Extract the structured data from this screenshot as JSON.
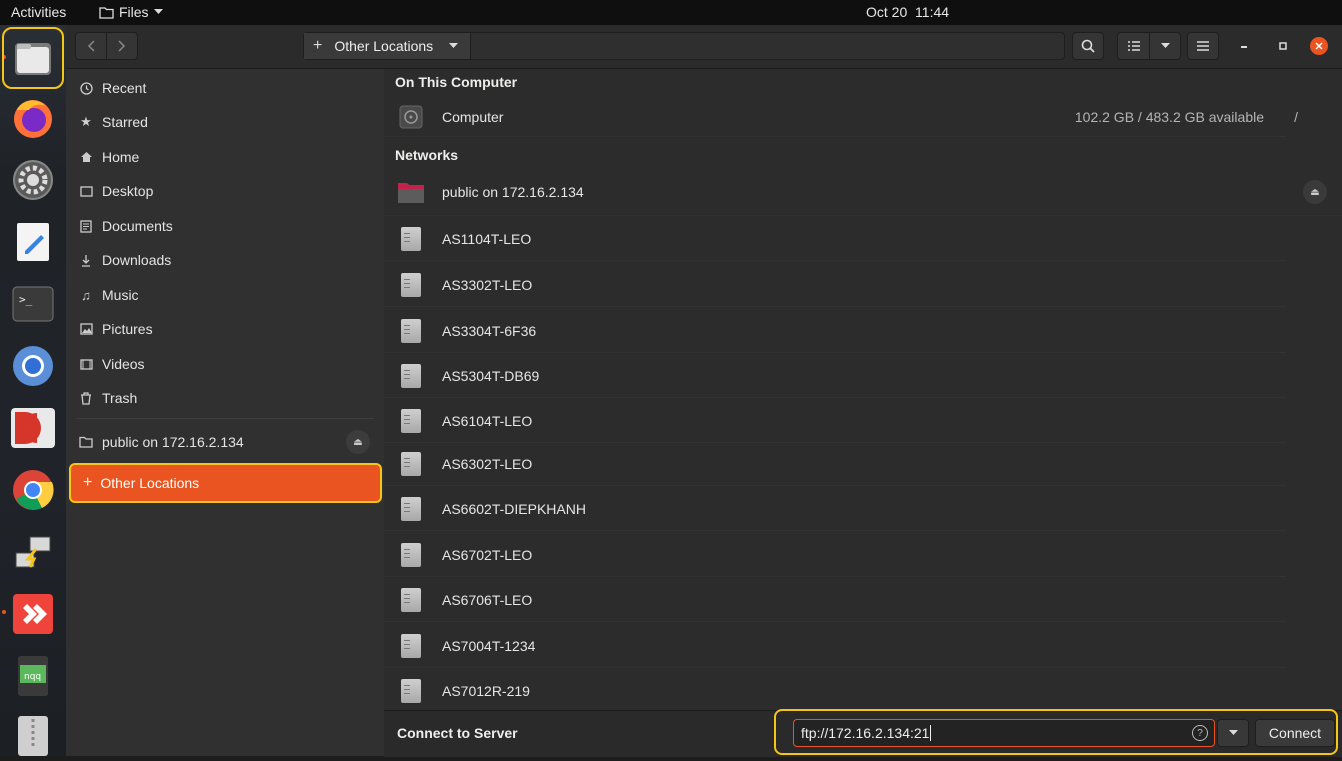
{
  "topbar": {
    "activities": "Activities",
    "app_menu": "Files",
    "date": "Oct 20",
    "time": "11:44"
  },
  "headerbar": {
    "location_label": "Other Locations"
  },
  "sidebar": {
    "items": [
      {
        "label": "Recent",
        "icon": "clock-icon"
      },
      {
        "label": "Starred",
        "icon": "star-icon"
      },
      {
        "label": "Home",
        "icon": "home-icon"
      },
      {
        "label": "Desktop",
        "icon": "desktop-icon"
      },
      {
        "label": "Documents",
        "icon": "document-icon"
      },
      {
        "label": "Downloads",
        "icon": "download-icon"
      },
      {
        "label": "Music",
        "icon": "music-icon"
      },
      {
        "label": "Pictures",
        "icon": "picture-icon"
      },
      {
        "label": "Videos",
        "icon": "video-icon"
      },
      {
        "label": "Trash",
        "icon": "trash-icon"
      }
    ],
    "mount": "public on 172.16.2.134",
    "other_locations": "Other Locations"
  },
  "main": {
    "on_this_computer": "On This Computer",
    "computer": {
      "name": "Computer",
      "space": "102.2 GB / 483.2 GB available",
      "path": "/"
    },
    "networks": "Networks",
    "mounted_share": "public on 172.16.2.134",
    "servers": [
      "AS1104T-LEO",
      "AS3302T-LEO",
      "AS3304T-6F36",
      "AS5304T-DB69",
      "AS6104T-LEO",
      "AS6302T-LEO",
      "AS6602T-DIEPKHANH",
      "AS6702T-LEO",
      "AS6706T-LEO",
      "AS7004T-1234",
      "AS7012R-219"
    ]
  },
  "connect": {
    "label": "Connect to Server",
    "address": "ftp://172.16.2.134:21",
    "button": "Connect"
  },
  "colors": {
    "accent": "#e95420",
    "highlight": "#f5c518"
  }
}
